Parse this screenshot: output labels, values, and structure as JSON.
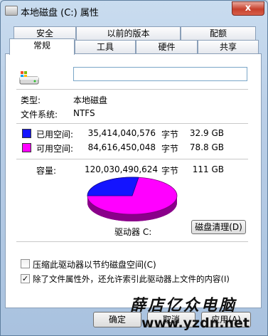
{
  "window": {
    "title": "本地磁盘 (C:) 属性",
    "close_label": "x"
  },
  "tabs_top": [
    "安全",
    "以前的版本",
    "配额"
  ],
  "tabs_bottom": [
    "常规",
    "工具",
    "硬件",
    "共享"
  ],
  "general": {
    "name_value": "",
    "type_label": "类型:",
    "type_value": "本地磁盘",
    "fs_label": "文件系统:",
    "fs_value": "NTFS",
    "used": {
      "label": "已用空间:",
      "bytes": "35,414,040,576",
      "unit": "字节",
      "size": "32.9 GB",
      "color": "#1414ff"
    },
    "free": {
      "label": "可用空间:",
      "bytes": "84,616,450,048",
      "unit": "字节",
      "size": "78.8 GB",
      "color": "#ff00ff"
    },
    "capacity": {
      "label": "容量:",
      "bytes": "120,030,490,624",
      "unit": "字节",
      "size": "111 GB"
    },
    "drive_label": "驱动器 C:",
    "cleanup_button": "磁盘清理(D)",
    "compress_checkbox": {
      "label": "压缩此驱动器以节约磁盘空间(C)",
      "checked": false
    },
    "index_checkbox": {
      "label": "除了文件属性外，还允许索引此驱动器上文件的内容(I)",
      "checked": true
    }
  },
  "buttons": {
    "ok": "确定",
    "cancel": "取消",
    "apply": "应用(A)"
  },
  "watermark": {
    "text": "薛店亿众电脑",
    "url": "www.yzdn.net"
  }
}
